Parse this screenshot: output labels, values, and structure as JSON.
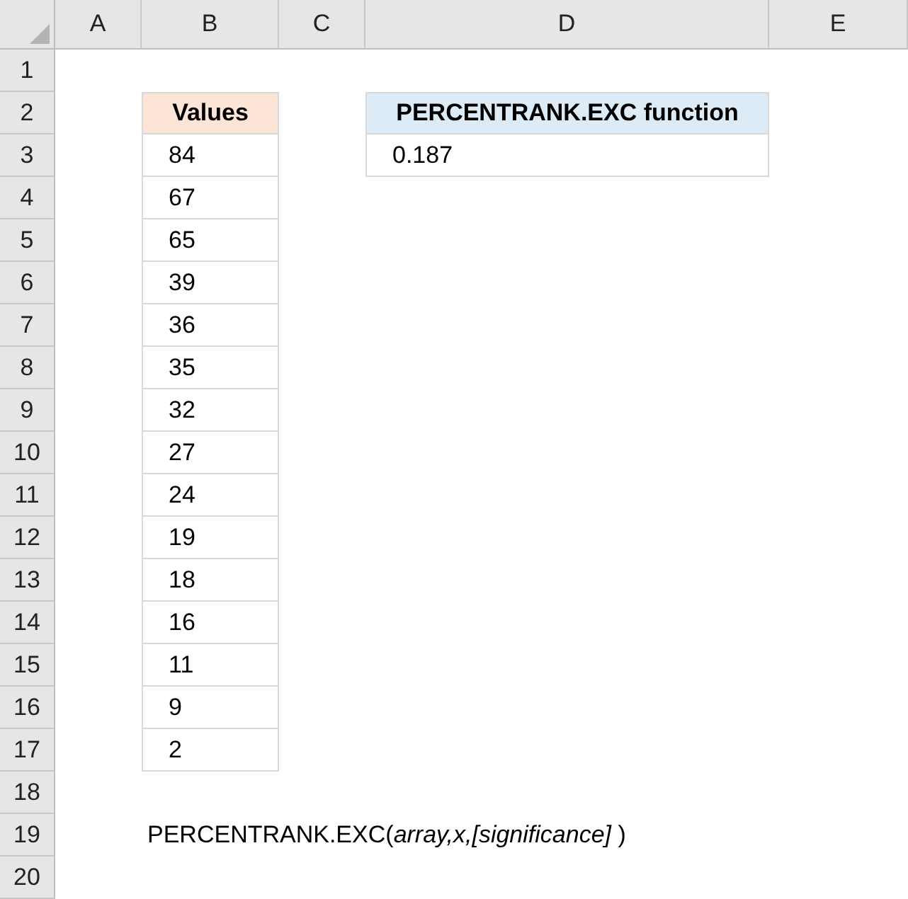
{
  "columns": [
    "A",
    "B",
    "C",
    "D",
    "E"
  ],
  "rows": [
    "1",
    "2",
    "3",
    "4",
    "5",
    "6",
    "7",
    "8",
    "9",
    "10",
    "11",
    "12",
    "13",
    "14",
    "15",
    "16",
    "17",
    "18",
    "19",
    "20"
  ],
  "values_table": {
    "header": "Values",
    "values": [
      "84",
      "67",
      "65",
      "39",
      "36",
      "35",
      "32",
      "27",
      "24",
      "19",
      "18",
      "16",
      "11",
      "9",
      "2"
    ]
  },
  "result_table": {
    "header": "PERCENTRANK.EXC function",
    "value": "0.187"
  },
  "syntax": "PERCENTRANK.EXC(*array,x,[significance]* )"
}
